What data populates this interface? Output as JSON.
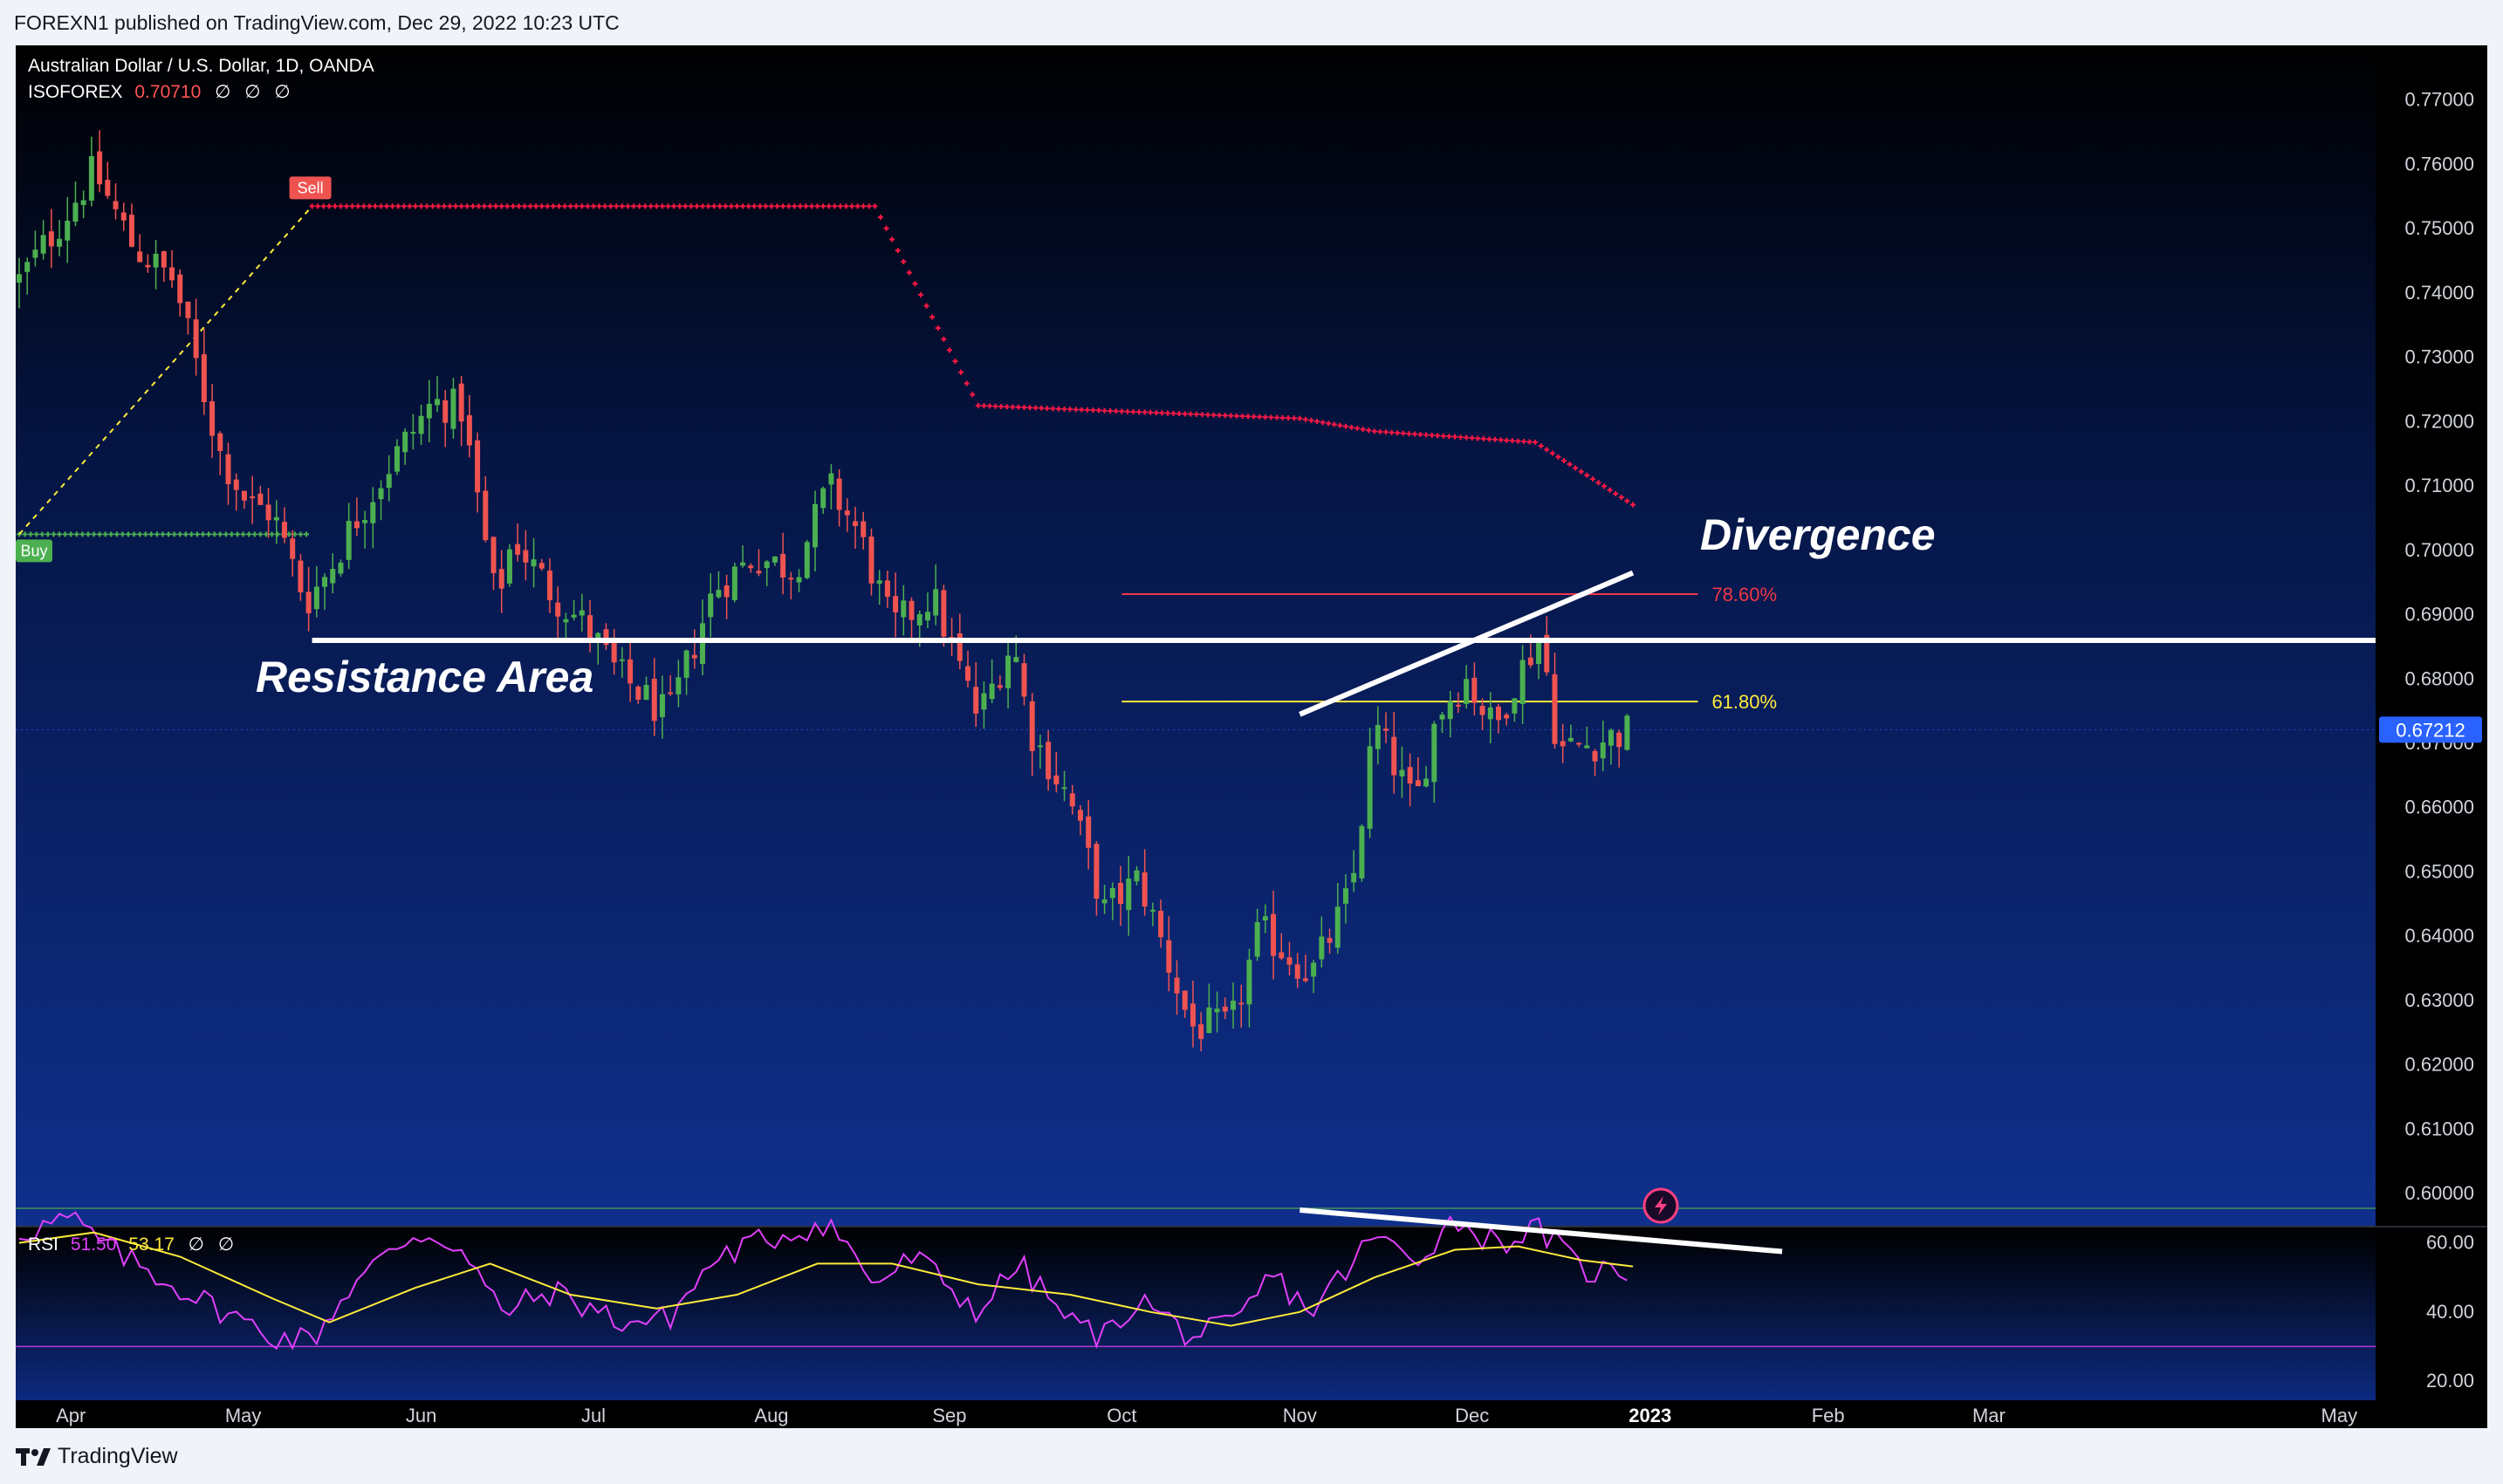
{
  "header": {
    "publisher_line": "FOREXN1 published on TradingView.com, Dec 29, 2022 10:23 UTC"
  },
  "footer": {
    "brand": "TradingView"
  },
  "colors": {
    "up": "#26a69a",
    "up_bright": "#4caf50",
    "down": "#ef5350",
    "stop_sell": "#ff1744",
    "stop_buy": "#4caf50",
    "fib_786": "#f23645",
    "fib_618": "#ffeb3b",
    "rsi": "#e040fb",
    "rsi_ma": "#ffeb3b",
    "price_tag": "#2962ff"
  },
  "chart_data": [
    {
      "type": "candlestick",
      "title": "Australian Dollar / U.S. Dollar, 1D, OANDA",
      "indicator": {
        "name": "ISOFOREX",
        "value": "0.70710",
        "params": [
          "∅",
          "∅",
          "∅"
        ]
      },
      "y_axis": {
        "ylim": [
          0.595,
          0.7785
        ],
        "ticks": [
          "0.77000",
          "0.76000",
          "0.75000",
          "0.74000",
          "0.73000",
          "0.72000",
          "0.71000",
          "0.70000",
          "0.69000",
          "0.68000",
          "0.67000",
          "0.66000",
          "0.65000",
          "0.64000",
          "0.63000",
          "0.62000",
          "0.61000",
          "0.60000"
        ],
        "tick_values": [
          0.77,
          0.76,
          0.75,
          0.74,
          0.73,
          0.72,
          0.71,
          0.7,
          0.69,
          0.68,
          0.67,
          0.66,
          0.65,
          0.64,
          0.63,
          0.62,
          0.61,
          0.6
        ]
      },
      "x_axis": {
        "labels": [
          "Apr",
          "May",
          "Jun",
          "Jul",
          "Aug",
          "Sep",
          "Oct",
          "Nov",
          "Dec",
          "2023",
          "Feb",
          "Mar",
          "May"
        ],
        "dates": [
          "2022-04-01",
          "2022-05-01",
          "2022-06-01",
          "2022-07-01",
          "2022-08-01",
          "2022-09-01",
          "2022-10-01",
          "2022-11-01",
          "2022-12-01",
          "2023-01-01",
          "2023-02-01",
          "2023-03-01",
          "2023-05-01"
        ]
      },
      "last_price": {
        "value": 0.67212,
        "label": "0.67212"
      },
      "ohlc_path": [
        [
          "2022-03-23",
          0.742
        ],
        [
          "2022-03-31",
          0.752
        ],
        [
          "2022-04-05",
          0.759
        ],
        [
          "2022-04-12",
          0.747
        ],
        [
          "2022-04-19",
          0.742
        ],
        [
          "2022-04-21",
          0.735
        ],
        [
          "2022-04-27",
          0.715
        ],
        [
          "2022-05-02",
          0.707
        ],
        [
          "2022-05-06",
          0.706
        ],
        [
          "2022-05-12",
          0.692
        ],
        [
          "2022-05-16",
          0.697
        ],
        [
          "2022-05-20",
          0.704
        ],
        [
          "2022-05-27",
          0.714
        ],
        [
          "2022-06-03",
          0.723
        ],
        [
          "2022-06-08",
          0.722
        ],
        [
          "2022-06-14",
          0.692
        ],
        [
          "2022-06-17",
          0.702
        ],
        [
          "2022-06-24",
          0.693
        ],
        [
          "2022-06-30",
          0.688
        ],
        [
          "2022-07-05",
          0.681
        ],
        [
          "2022-07-14",
          0.674
        ],
        [
          "2022-07-22",
          0.694
        ],
        [
          "2022-07-29",
          0.699
        ],
        [
          "2022-08-05",
          0.697
        ],
        [
          "2022-08-11",
          0.71
        ],
        [
          "2022-08-16",
          0.703
        ],
        [
          "2022-08-22",
          0.688
        ],
        [
          "2022-08-29",
          0.693
        ],
        [
          "2022-09-06",
          0.674
        ],
        [
          "2022-09-12",
          0.686
        ],
        [
          "2022-09-15",
          0.672
        ],
        [
          "2022-09-22",
          0.661
        ],
        [
          "2022-09-28",
          0.644
        ],
        [
          "2022-10-04",
          0.649
        ],
        [
          "2022-10-13",
          0.626
        ],
        [
          "2022-10-20",
          0.626
        ],
        [
          "2022-10-25",
          0.641
        ],
        [
          "2022-11-03",
          0.634
        ],
        [
          "2022-11-10",
          0.647
        ],
        [
          "2022-11-14",
          0.673
        ],
        [
          "2022-11-21",
          0.66
        ],
        [
          "2022-11-25",
          0.675
        ],
        [
          "2022-11-30",
          0.68
        ],
        [
          "2022-12-05",
          0.672
        ],
        [
          "2022-12-08",
          0.679
        ],
        [
          "2022-12-13",
          0.687
        ],
        [
          "2022-12-16",
          0.669
        ],
        [
          "2022-12-22",
          0.67
        ],
        [
          "2022-12-29",
          0.67212
        ]
      ],
      "trailing_stop": {
        "sell": {
          "label": "Sell",
          "date": "2022-05-13",
          "path": [
            [
              "2022-05-13",
              0.7535
            ],
            [
              "2022-08-19",
              0.7535
            ],
            [
              "2022-09-06",
              0.7225
            ],
            [
              "2022-11-01",
              0.7205
            ],
            [
              "2022-11-14",
              0.7185
            ],
            [
              "2022-12-12",
              0.7168
            ],
            [
              "2022-12-29",
              0.7071
            ]
          ]
        },
        "buy": {
          "label": "Buy",
          "date": "2022-03-23",
          "path": [
            [
              "2022-03-23",
              0.7025
            ],
            [
              "2022-05-13",
              0.7025
            ]
          ]
        }
      },
      "fibonacci": [
        {
          "label": "78.60%",
          "value": 0.6932
        },
        {
          "label": "61.80%",
          "value": 0.6765
        }
      ],
      "annotations": [
        {
          "text": "Resistance Area",
          "kind": "horizontal_line",
          "value": 0.686,
          "from": "2022-05-13",
          "to": "2023-05-01"
        },
        {
          "text": "Divergence",
          "kind": "trend_line",
          "points": [
            [
              "2022-11-01",
              0.6745
            ],
            [
              "2022-12-29",
              0.6965
            ]
          ]
        }
      ]
    },
    {
      "type": "line",
      "title": "RSI",
      "rsi_value": "51.50",
      "ma_value": "53.17",
      "params": [
        "∅",
        "∅"
      ],
      "y_axis": {
        "ylim": [
          20,
          70
        ],
        "ticks": [
          "60.00",
          "40.00",
          "20.00"
        ],
        "levels": [
          70,
          30
        ]
      },
      "rsi_path": [
        [
          "2022-03-23",
          63
        ],
        [
          "2022-04-01",
          67
        ],
        [
          "2022-04-08",
          58
        ],
        [
          "2022-04-22",
          45
        ],
        [
          "2022-05-06",
          33
        ],
        [
          "2022-05-13",
          32
        ],
        [
          "2022-05-20",
          48
        ],
        [
          "2022-05-31",
          63
        ],
        [
          "2022-06-07",
          60
        ],
        [
          "2022-06-15",
          40
        ],
        [
          "2022-06-24",
          46
        ],
        [
          "2022-07-06",
          37
        ],
        [
          "2022-07-14",
          38
        ],
        [
          "2022-07-22",
          55
        ],
        [
          "2022-07-29",
          60
        ],
        [
          "2022-08-11",
          66
        ],
        [
          "2022-08-19",
          48
        ],
        [
          "2022-08-26",
          56
        ],
        [
          "2022-09-06",
          40
        ],
        [
          "2022-09-13",
          54
        ],
        [
          "2022-09-22",
          37
        ],
        [
          "2022-09-28",
          33
        ],
        [
          "2022-10-04",
          44
        ],
        [
          "2022-10-13",
          33
        ],
        [
          "2022-10-21",
          36
        ],
        [
          "2022-10-27",
          51
        ],
        [
          "2022-11-03",
          40
        ],
        [
          "2022-11-14",
          62
        ],
        [
          "2022-11-21",
          55
        ],
        [
          "2022-11-28",
          67
        ],
        [
          "2022-12-05",
          60
        ],
        [
          "2022-12-13",
          64
        ],
        [
          "2022-12-20",
          52
        ],
        [
          "2022-12-29",
          51.5
        ]
      ],
      "ma_path": [
        [
          "2022-03-23",
          60
        ],
        [
          "2022-04-05",
          63
        ],
        [
          "2022-04-20",
          56
        ],
        [
          "2022-05-06",
          44
        ],
        [
          "2022-05-16",
          37
        ],
        [
          "2022-05-31",
          47
        ],
        [
          "2022-06-13",
          54
        ],
        [
          "2022-06-27",
          45
        ],
        [
          "2022-07-12",
          41
        ],
        [
          "2022-07-26",
          45
        ],
        [
          "2022-08-09",
          54
        ],
        [
          "2022-08-22",
          54
        ],
        [
          "2022-09-06",
          48
        ],
        [
          "2022-09-22",
          45
        ],
        [
          "2022-10-06",
          40
        ],
        [
          "2022-10-20",
          36
        ],
        [
          "2022-11-01",
          40
        ],
        [
          "2022-11-14",
          50
        ],
        [
          "2022-11-28",
          58
        ],
        [
          "2022-12-09",
          59
        ],
        [
          "2022-12-20",
          55
        ],
        [
          "2022-12-29",
          53.17
        ]
      ],
      "annotation": {
        "kind": "trend_line",
        "points": [
          [
            "2022-11-01",
            69.5
          ],
          [
            "2023-01-24",
            57.5
          ]
        ]
      }
    }
  ]
}
